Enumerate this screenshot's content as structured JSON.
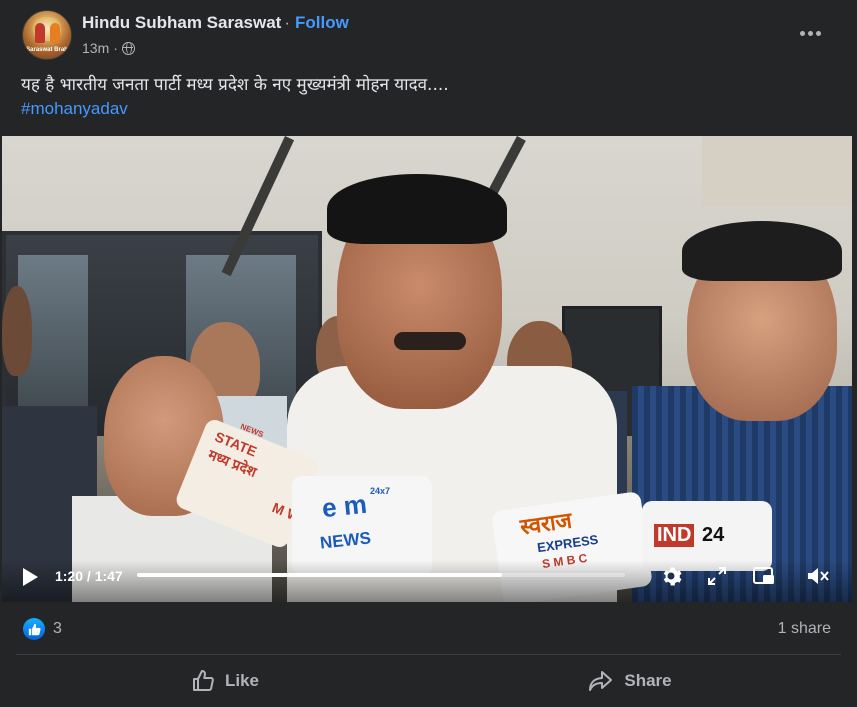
{
  "post": {
    "author": "Hindu Subham Saraswat",
    "separator": "·",
    "follow_label": "Follow",
    "time": "13m",
    "time_separator": "·",
    "privacy_icon": "globe-icon",
    "avatar_text": "Saraswat Brah",
    "more_icon": "more-options-icon",
    "text": "यह है भारतीय जनता पार्टी मध्य प्रदेश के नए मुख्यमंत्री मोहन यादव....",
    "hashtag": "#mohanyadav"
  },
  "video": {
    "mic_labels": {
      "state": "STATE",
      "news_small": "NEWS",
      "madhya": "मध्य प्रदेश",
      "mw": "M W",
      "emn_logo": "e m",
      "emn_news": "NEWS",
      "emn_247": "24x7",
      "swaraj": "स्वराज",
      "express": "EXPRESS",
      "smbc": "S M B C",
      "ind": "IND",
      "ind24": "24"
    },
    "current_time": "1:20",
    "duration": "1:47",
    "time_display": "1:20 / 1:47",
    "progress_fraction": 0.748,
    "icons": [
      "play-icon",
      "settings-icon",
      "fullscreen-icon",
      "picture-in-picture-icon",
      "mute-icon"
    ]
  },
  "reactions": {
    "like_count": "3",
    "share_count": "1 share"
  },
  "actions": {
    "like_label": "Like",
    "share_label": "Share"
  },
  "colors": {
    "background": "#242526",
    "text": "#e4e6eb",
    "secondary": "#b0b3b8",
    "link": "#4599ff",
    "like_blue": "#0062df"
  }
}
